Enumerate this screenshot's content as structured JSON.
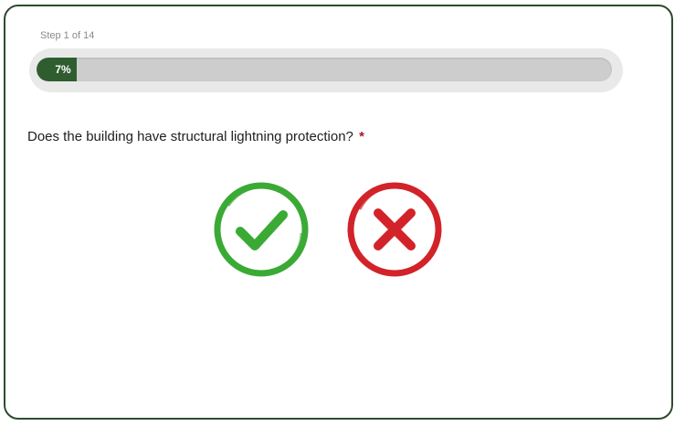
{
  "step": {
    "label": "Step 1 of 14"
  },
  "progress": {
    "value": 0.07,
    "text": "7%",
    "fill_color": "#2f5d2f"
  },
  "question": {
    "text": "Does the building have structural lightning protection?",
    "required_mark": "*"
  },
  "answers": {
    "yes": {
      "icon": "checkmark-circle-icon",
      "color": "#3aaa35"
    },
    "no": {
      "icon": "x-circle-icon",
      "color": "#d2232a"
    }
  }
}
